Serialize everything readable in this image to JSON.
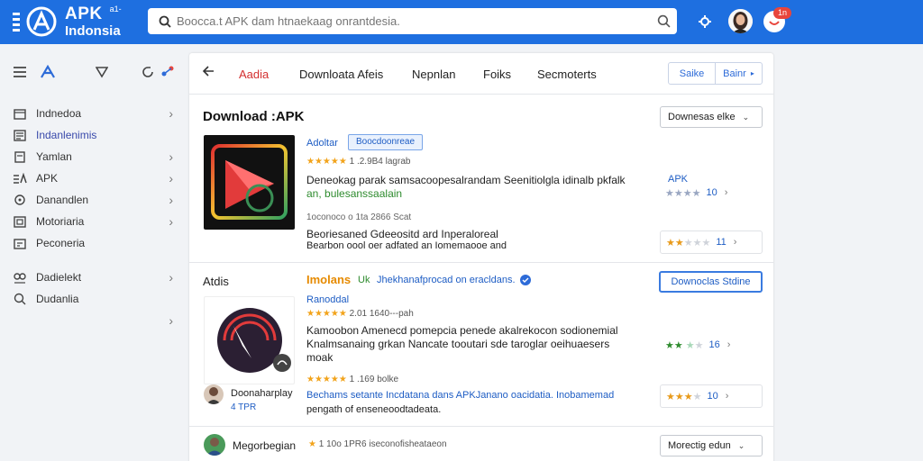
{
  "header": {
    "logo_apk": "APK",
    "logo_version": "a1-",
    "logo_sub": "Indonsia",
    "search_placeholder": "Boocca.t APK dam htnaekaag onrantdesia.",
    "notif_count": "1n",
    "brand_color": "#1e6fe0"
  },
  "sidebar": {
    "items": [
      {
        "label": "Indnedoa",
        "icon": "folder-icon",
        "chevron": true
      },
      {
        "label": "Indanlenimis",
        "icon": "list-icon",
        "chevron": false,
        "active": true
      },
      {
        "label": "Yamlan",
        "icon": "document-icon",
        "chevron": true
      },
      {
        "label": "APK",
        "icon": "apk-icon",
        "chevron": true
      },
      {
        "label": "Danandlen",
        "icon": "chat-icon",
        "chevron": true
      },
      {
        "label": "Motoriaria",
        "icon": "box-icon",
        "chevron": true
      },
      {
        "label": "Peconeria",
        "icon": "calendar-icon",
        "chevron": false
      },
      {
        "label": "Dadielekt",
        "icon": "group-icon",
        "chevron": true
      },
      {
        "label": "Dudanlia",
        "icon": "settings-icon",
        "chevron": false
      }
    ]
  },
  "tabs": {
    "active": "Aadia",
    "items": [
      "Downloata Afeis",
      "Nepnlan",
      "Foiks",
      "Secmoterts"
    ],
    "seg_left": "Saike",
    "seg_right": "Bainr"
  },
  "section1": {
    "title": "Download :APK",
    "dropdown": "Downesas elke",
    "app": {
      "name": "Adoltar",
      "tag": "Boocdoonreae",
      "rating_text": "1 .2.9B4 lagrab",
      "desc1": "Deneokag parak samsacoopesalrandam Seenitiolgla idinalb pkfalk",
      "desc2": "an, bulesanssaalain",
      "meta": "1oconoco o 1ta 2866 Scat",
      "feature1": "Beoriesaned Gdeeositd ard Inperaloreal",
      "feature2": "Bearbon oool oer adfated an Iomemaooe and",
      "side_label": "APK",
      "side_num": "10",
      "rate_num": "11"
    }
  },
  "section2": {
    "label": "Atdis",
    "app": {
      "title_orange": "Imolans",
      "title_rest": "Jhekhanafprocad on eracldans.",
      "title_green": "Uk",
      "button": "Downoclas Stdine",
      "sub": "Ranoddal",
      "rating_text": "2.01 1640---pah",
      "desc1": "Kamoobon Amenecd pomepcia penede akalrekocon sodionemial",
      "desc2": "Knalmsanaing grkan Nancate tooutari sde taroglar oeihuaesers",
      "desc3": "moak",
      "rating2_text": "1 .169 bolke",
      "foot_blue": "Bechams setante",
      "foot_rest": "Incdatana dans APKJanano oacidatia. Inobamemad",
      "foot2": "pengath  of enseneoodtadeata.",
      "pub_name": "Doonaharplay",
      "pub_sub": "4 TPR",
      "rate1_num": "16",
      "rate2_num": "10"
    }
  },
  "section3": {
    "name": "Megorbegian",
    "rating_text": "1 10o 1PR6 iseconofisheataeon",
    "dropdown": "Morectig edun"
  }
}
